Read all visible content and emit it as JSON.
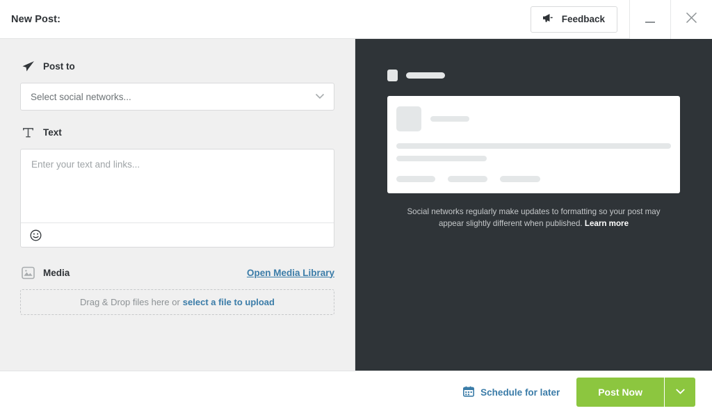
{
  "window": {
    "title": "New Post:",
    "feedback_label": "Feedback",
    "feedback_icon": "megaphone-icon",
    "minimize_icon": "minimize-icon",
    "close_icon": "close-icon"
  },
  "compose": {
    "post_to": {
      "label": "Post to",
      "icon": "paper-plane-icon",
      "select_value": "Select social networks...",
      "chevron_icon": "chevron-down-icon"
    },
    "text": {
      "label": "Text",
      "icon": "text-t-icon",
      "placeholder": "Enter your text and links...",
      "value": "",
      "emoji_icon": "emoji-smiley-icon"
    },
    "media": {
      "label": "Media",
      "icon": "image-icon",
      "library_link": "Open Media Library",
      "dropzone_text": "Drag & Drop files here or",
      "dropzone_link": "select a file to upload"
    }
  },
  "preview": {
    "note_text": "Social networks regularly make updates to formatting so your post may appear slightly different when published.",
    "note_link": "Learn more",
    "background_color": "#2f3438",
    "skeleton_color": "#e4e6e7"
  },
  "footer": {
    "schedule_label": "Schedule for later",
    "schedule_icon": "calendar-icon",
    "post_now_label": "Post Now",
    "post_caret_icon": "chevron-down-icon",
    "accent_green": "#8cc63f",
    "link_blue": "#3b7ca8"
  }
}
